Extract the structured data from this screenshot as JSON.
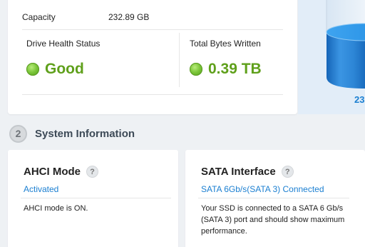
{
  "drive_info": {
    "capacity_label": "Capacity",
    "capacity_value": "232.89 GB",
    "health_label": "Drive Health Status",
    "health_value": "Good",
    "tbw_label": "Total Bytes Written",
    "tbw_value": "0.39 TB",
    "status_color": "#5fa01b"
  },
  "chart": {
    "label_fragment": "23",
    "fill_color": "#1b7fd1"
  },
  "system_information": {
    "number": "2",
    "title": "System Information"
  },
  "ahci": {
    "title": "AHCI Mode",
    "help": "?",
    "status": "Activated",
    "description": "AHCI mode is ON."
  },
  "sata": {
    "title": "SATA Interface",
    "help": "?",
    "status": "SATA 6Gb/s(SATA 3) Connected",
    "description": "Your SSD is connected to a SATA 6 Gb/s (SATA 3) port and should show maximum performance."
  }
}
